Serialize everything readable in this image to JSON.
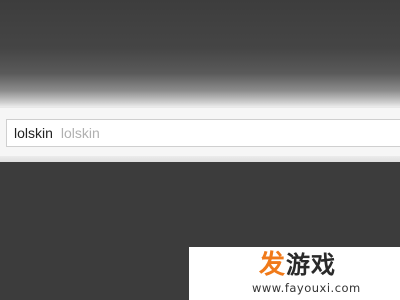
{
  "search": {
    "typed_text": "lolskin",
    "suggestion_text": "lolskin"
  },
  "watermark": {
    "brand_first_char": "发",
    "brand_rest": "游戏",
    "url": "www.fayouxi.com"
  },
  "colors": {
    "background_dark": "#3b3b3b",
    "search_bar_bg": "#f6f6f6",
    "suggestion_gray": "#b0b0b0",
    "brand_orange": "#f07a1a"
  }
}
